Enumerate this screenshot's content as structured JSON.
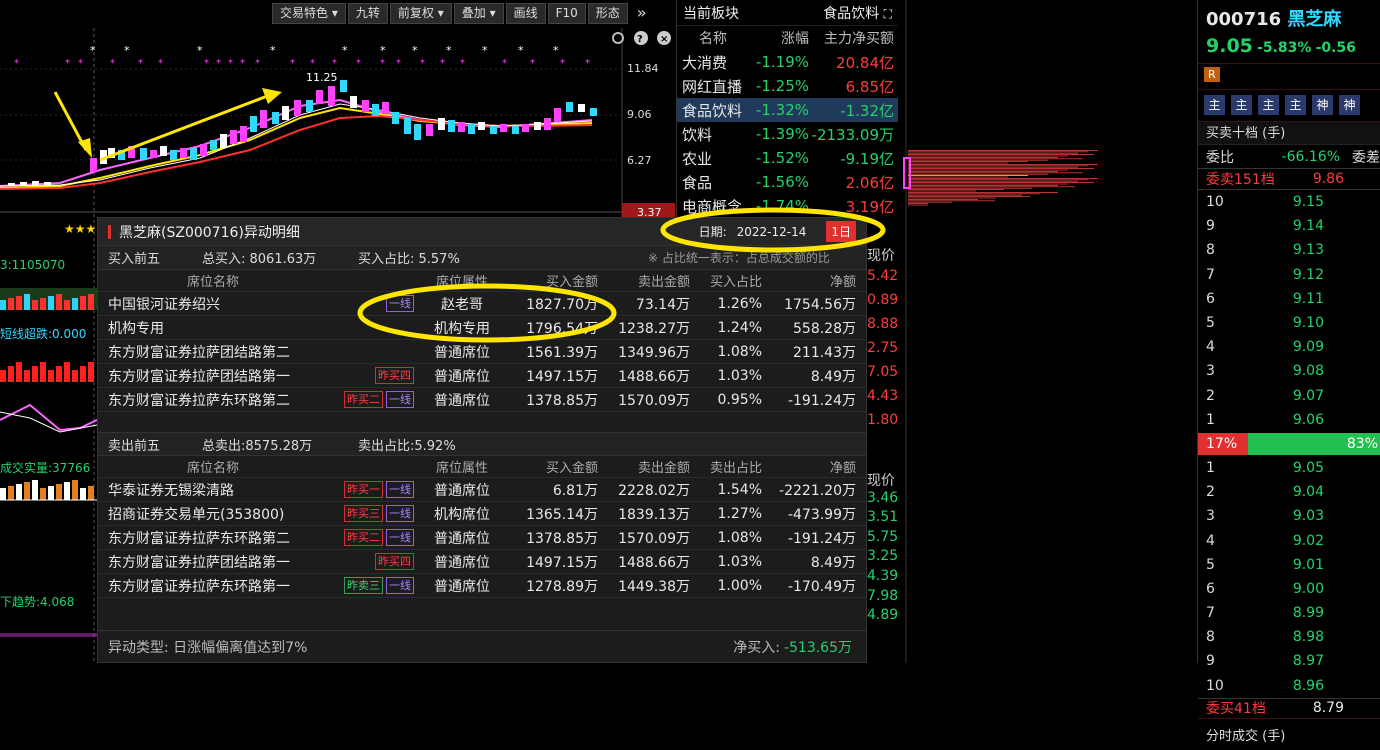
{
  "toolbar": [
    "交易特色",
    "九转",
    "前复权",
    "叠加",
    "画线",
    "F10",
    "形态"
  ],
  "chart": {
    "price_labels": [
      "11.84",
      "9.06",
      "6.27",
      "3.37"
    ],
    "high_label": "11.25",
    "left_labels": {
      "vol": "3:1105070",
      "short": "短线超跌:0.000",
      "deal": "成交实量:37766",
      "trend": "下趋势:4.068"
    }
  },
  "sector": {
    "title": "当前板块",
    "current": "食品饮料",
    "headers": [
      "名称",
      "涨幅",
      "主力净买额"
    ],
    "rows": [
      {
        "name": "大消费",
        "pct": "-1.19%",
        "net": "20.84亿"
      },
      {
        "name": "网红直播",
        "pct": "-1.25%",
        "net": "6.85亿"
      },
      {
        "name": "食品饮料",
        "pct": "-1.32%",
        "net": "-1.32亿"
      },
      {
        "name": "饮料",
        "pct": "-1.39%",
        "net": "-2133.09万"
      },
      {
        "name": "农业",
        "pct": "-1.52%",
        "net": "-9.19亿"
      },
      {
        "name": "食品",
        "pct": "-1.56%",
        "net": "2.06亿"
      },
      {
        "name": "电商概念",
        "pct": "-1.74%",
        "net": "3.19亿"
      }
    ]
  },
  "panel": {
    "title": "黑芝麻(SZ000716)异动明细",
    "date_label": "日期:",
    "date": "2022-12-14",
    "period": "1日",
    "buy": {
      "title": "买入前五",
      "total": "总买入: 8061.63万",
      "ratio": "买入占比: 5.57%",
      "note": "※ 占比统一表示：占总成交额的比",
      "headers": [
        "席位名称",
        "席位属性",
        "买入金额",
        "卖出金额",
        "买入占比",
        "净额"
      ],
      "rows": [
        {
          "name": "中国银河证券绍兴",
          "tags": [
            {
              "t": "一线",
              "c": "p"
            }
          ],
          "attr": "赵老哥",
          "buy": "1827.70万",
          "sell": "73.14万",
          "pct": "1.26%",
          "net": "1754.56万"
        },
        {
          "name": "机构专用",
          "tags": [],
          "attr": "机构专用",
          "buy": "1796.54万",
          "sell": "1238.27万",
          "pct": "1.24%",
          "net": "558.28万"
        },
        {
          "name": "东方财富证券拉萨团结路第二",
          "tags": [],
          "attr": "普通席位",
          "buy": "1561.39万",
          "sell": "1349.96万",
          "pct": "1.08%",
          "net": "211.43万"
        },
        {
          "name": "东方财富证券拉萨团结路第一",
          "tags": [
            {
              "t": "昨买四",
              "c": "r"
            }
          ],
          "attr": "普通席位",
          "buy": "1497.15万",
          "sell": "1488.66万",
          "pct": "1.03%",
          "net": "8.49万"
        },
        {
          "name": "东方财富证券拉萨东环路第二",
          "tags": [
            {
              "t": "昨买二",
              "c": "r"
            },
            {
              "t": "一线",
              "c": "p"
            }
          ],
          "attr": "普通席位",
          "buy": "1378.85万",
          "sell": "1570.09万",
          "pct": "0.95%",
          "net": "-191.24万"
        }
      ]
    },
    "sell": {
      "title": "卖出前五",
      "total": "总卖出:8575.28万",
      "ratio": "卖出占比:5.92%",
      "headers": [
        "席位名称",
        "席位属性",
        "买入金额",
        "卖出金额",
        "卖出占比",
        "净额"
      ],
      "rows": [
        {
          "name": "华泰证券无锡梁清路",
          "tags": [
            {
              "t": "昨买一",
              "c": "r"
            },
            {
              "t": "一线",
              "c": "p"
            }
          ],
          "attr": "普通席位",
          "buy": "6.81万",
          "sell": "2228.02万",
          "pct": "1.54%",
          "net": "-2221.20万"
        },
        {
          "name": "招商证券交易单元(353800)",
          "tags": [
            {
              "t": "昨买三",
              "c": "r"
            },
            {
              "t": "一线",
              "c": "p"
            }
          ],
          "attr": "机构席位",
          "buy": "1365.14万",
          "sell": "1839.13万",
          "pct": "1.27%",
          "net": "-473.99万"
        },
        {
          "name": "东方财富证券拉萨东环路第二",
          "tags": [
            {
              "t": "昨买二",
              "c": "r"
            },
            {
              "t": "一线",
              "c": "p"
            }
          ],
          "attr": "普通席位",
          "buy": "1378.85万",
          "sell": "1570.09万",
          "pct": "1.08%",
          "net": "-191.24万"
        },
        {
          "name": "东方财富证券拉萨团结路第一",
          "tags": [
            {
              "t": "昨买四",
              "c": "r"
            }
          ],
          "attr": "普通席位",
          "buy": "1497.15万",
          "sell": "1488.66万",
          "pct": "1.03%",
          "net": "8.49万"
        },
        {
          "name": "东方财富证券拉萨东环路第一",
          "tags": [
            {
              "t": "昨卖三",
              "c": "g"
            },
            {
              "t": "一线",
              "c": "p"
            }
          ],
          "attr": "普通席位",
          "buy": "1278.89万",
          "sell": "1449.38万",
          "pct": "1.00%",
          "net": "-170.49万"
        }
      ]
    },
    "footer_type": "异动类型: 日涨幅偏离值达到7%",
    "footer_net_label": "净买入:",
    "footer_net": "-513.65万"
  },
  "side_nums": [
    "5.42",
    "0.89",
    "8.88",
    "2.75",
    "7.05",
    "4.43",
    "1.80",
    "现价",
    "3.46",
    "3.51",
    "5.75",
    "3.25",
    "4.39",
    "7.98",
    "4.89"
  ],
  "side_top": "现价",
  "stock": {
    "code": "000716",
    "name": "黑芝麻",
    "price": "9.05",
    "change_pct": "-5.83%",
    "change": "-0.56",
    "badge": "R",
    "chips": [
      "主",
      "主",
      "主",
      "主",
      "神",
      "神"
    ],
    "ob_title": "买卖十档 (手)",
    "weibi_label": "委比",
    "weibi": "-66.16%",
    "weicha": "委差",
    "sell_levels_label": "委卖151档",
    "sell_levels_price": "9.86",
    "asks": [
      {
        "l": "10",
        "p": "9.15"
      },
      {
        "l": "9",
        "p": "9.14"
      },
      {
        "l": "8",
        "p": "9.13"
      },
      {
        "l": "7",
        "p": "9.12"
      },
      {
        "l": "6",
        "p": "9.11"
      },
      {
        "l": "5",
        "p": "9.10"
      },
      {
        "l": "4",
        "p": "9.09"
      },
      {
        "l": "3",
        "p": "9.08"
      },
      {
        "l": "2",
        "p": "9.07"
      },
      {
        "l": "1",
        "p": "9.06"
      }
    ],
    "ratio_sell": "17%",
    "ratio_buy": "83%",
    "bids": [
      {
        "l": "1",
        "p": "9.05"
      },
      {
        "l": "2",
        "p": "9.04"
      },
      {
        "l": "3",
        "p": "9.03"
      },
      {
        "l": "4",
        "p": "9.02"
      },
      {
        "l": "5",
        "p": "9.01"
      },
      {
        "l": "6",
        "p": "9.00"
      },
      {
        "l": "7",
        "p": "8.99"
      },
      {
        "l": "8",
        "p": "8.98"
      },
      {
        "l": "9",
        "p": "8.97"
      },
      {
        "l": "10",
        "p": "8.96"
      }
    ],
    "buy_levels_label": "委买41档",
    "buy_levels_price": "8.79",
    "bottom_label": "分时成交 (手)"
  },
  "colors": {
    "up": "#ff3c3c",
    "down": "#22d36a",
    "highlight": "#ffe600",
    "panel": "#1c1c1c"
  }
}
